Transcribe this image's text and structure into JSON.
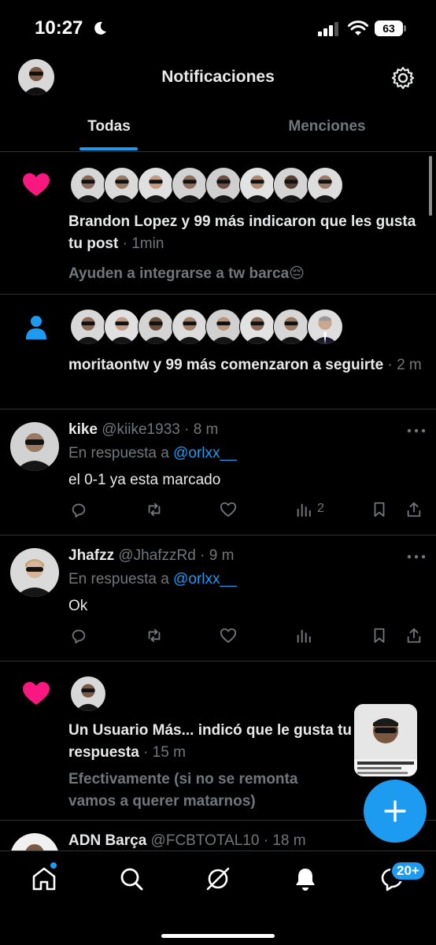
{
  "status_bar": {
    "time": "10:27",
    "battery": "63"
  },
  "header": {
    "title": "Notificaciones"
  },
  "tabs": [
    {
      "label": "Todas"
    },
    {
      "label": "Menciones"
    }
  ],
  "notifications": [
    {
      "type": "like",
      "text": "Brandon Lopez y 99 más indicaron que les gusta tu post",
      "time": " · 1min",
      "subtext": "Ayuden a integrarse a tw barca😔"
    },
    {
      "type": "follow",
      "text": "moritaontw y 99 más comenzaron a seguirte",
      "time": " · 2 m"
    },
    {
      "type": "reply",
      "name": "kike",
      "handle": " @kiike1933 · 8 m",
      "reply_prefix": "En respuesta a ",
      "reply_to": "@orlxx__",
      "body": "el 0-1 ya esta marcado",
      "views": "2"
    },
    {
      "type": "reply",
      "name": "Jhafzz",
      "handle": " @JhafzzRd · 9 m",
      "reply_prefix": "En respuesta a ",
      "reply_to": "@orlxx__",
      "body": "Ok"
    },
    {
      "type": "like",
      "text": "Un Usuario Más... indicó que le gusta tu respuesta",
      "time": " · 15 m",
      "subtext": "Efectivamente (si no se remonta vamos a querer matarnos)"
    },
    {
      "type": "reply",
      "name": "ADN Barça",
      "handle": " @FCBTOTAL10 · 18 m"
    }
  ],
  "nav": {
    "messages_badge": "20+"
  },
  "colors": {
    "accent": "#1d9bf0",
    "like": "#f91880",
    "muted": "#71767b"
  }
}
